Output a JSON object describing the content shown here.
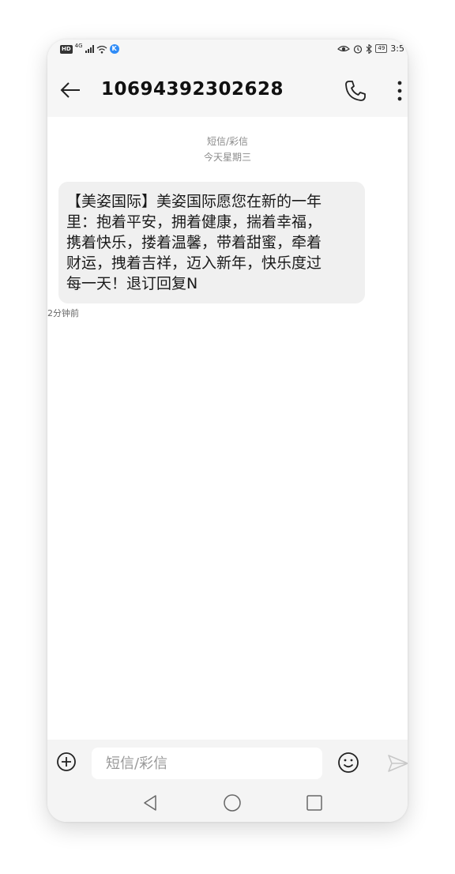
{
  "status_bar": {
    "hd_badge": "HD",
    "network": "4G",
    "k_badge": "K",
    "battery": "49",
    "time": "3:5"
  },
  "header": {
    "title": "10694392302628",
    "back_icon": "back-arrow-icon",
    "call_icon": "phone-icon",
    "more_icon": "more-vertical-icon"
  },
  "conversation": {
    "sim_label": "短信/彩信",
    "date_label": "今天星期三",
    "message": {
      "lines": [
        "【美姿国际】美姿国际愿您在新的一年",
        "里：抱着平安，拥着健康，揣着幸福，",
        "携着快乐，搂着温馨，带着甜蜜，牵着",
        "财运，拽着吉祥，迈入新年，快乐度过",
        "每一天！退订回复N"
      ],
      "time": "2分钟前"
    }
  },
  "input_bar": {
    "placeholder": "短信/彩信",
    "add_icon": "add-circle-icon",
    "emoji_icon": "emoji-icon",
    "send_icon": "send-icon"
  },
  "nav_bar": {
    "back_icon": "nav-back-icon",
    "home_icon": "nav-home-icon",
    "recent_icon": "nav-recent-icon"
  },
  "colors": {
    "bar_background": "#f6f6f6",
    "bubble_background": "#f0f0f0",
    "k_badge": "#2f8cf7"
  }
}
